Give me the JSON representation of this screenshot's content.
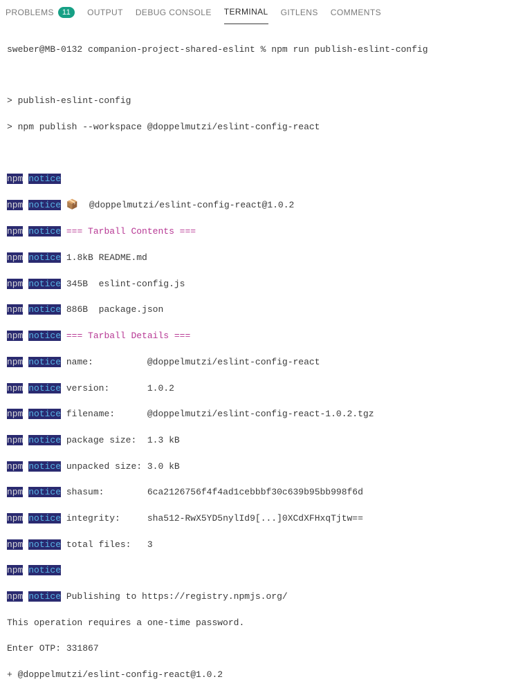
{
  "tabs": {
    "problems": "PROBLEMS",
    "problems_count": "11",
    "output": "OUTPUT",
    "debug": "DEBUG CONSOLE",
    "terminal": "TERMINAL",
    "gitlens": "GITLENS",
    "comments": "COMMENTS"
  },
  "term": {
    "prompt": "sweber@MB-0132 companion-project-shared-eslint % npm run publish-eslint-config",
    "script_name": "> publish-eslint-config",
    "script_cmd": "> npm publish --workspace @doppelmutzi/eslint-config-react",
    "pkg_emoji": "📦",
    "pkg_full": "  @doppelmutzi/eslint-config-react@1.0.2",
    "hdr_contents": "=== Tarball Contents ===",
    "f1": "1.8kB README.md",
    "f2": "345B  eslint-config.js",
    "f3": "886B  package.json",
    "hdr_details": "=== Tarball Details ===",
    "d_name": "name:          @doppelmutzi/eslint-config-react",
    "d_ver": "version:       1.0.2",
    "d_file": "filename:      @doppelmutzi/eslint-config-react-1.0.2.tgz",
    "d_psize": "package size:  1.3 kB",
    "d_usize": "unpacked size: 3.0 kB",
    "d_shasum": "shasum:        6ca2126756f4f4ad1cebbbf30c639b95bb998f6d",
    "d_integ": "integrity:     sha512-RwX5YD5nylId9[...]0XCdXFHxqTjtw==",
    "d_total": "total files:   3",
    "publishing": " Publishing to https://registry.npmjs.org/",
    "otp_req": "This operation requires a one-time password.",
    "otp_enter": "Enter OTP: 331867",
    "result": "+ @doppelmutzi/eslint-config-react@1.0.2",
    "npm": "npm",
    "notice": "notice"
  }
}
